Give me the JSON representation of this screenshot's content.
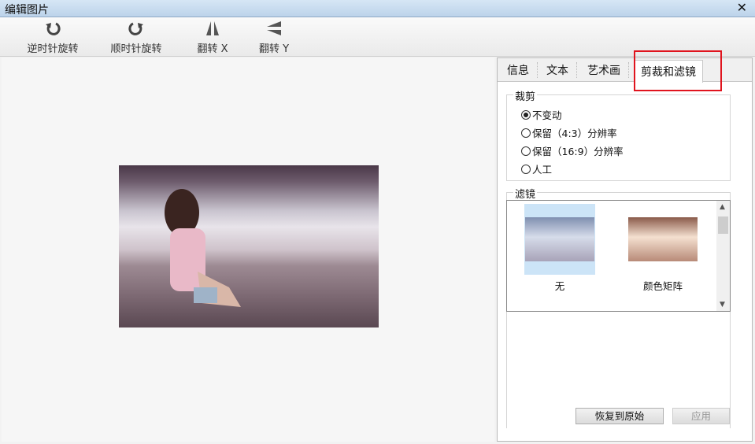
{
  "window": {
    "title": "编辑图片",
    "close": "✕"
  },
  "toolbar": [
    {
      "label": "逆时针旋转",
      "icon": "rotate-ccw-icon"
    },
    {
      "label": "顺时针旋转",
      "icon": "rotate-cw-icon"
    },
    {
      "label": "翻转 X",
      "icon": "flip-x-icon"
    },
    {
      "label": "翻转 Y",
      "icon": "flip-y-icon"
    }
  ],
  "tabs": [
    "信息",
    "文本",
    "艺术画",
    "剪裁和滤镜"
  ],
  "crop": {
    "title": "裁剪",
    "options": [
      "不变动",
      "保留（4:3）分辨率",
      "保留（16:9）分辨率",
      "人工"
    ],
    "selected": 0
  },
  "filter": {
    "title": "滤镜",
    "items": [
      "无",
      "颜色矩阵"
    ],
    "selected": 0
  },
  "buttons": {
    "restore": "恢复到原始",
    "apply": "应用"
  },
  "colors": {
    "highlight": "#e0141e",
    "selection": "#cce4f7"
  }
}
